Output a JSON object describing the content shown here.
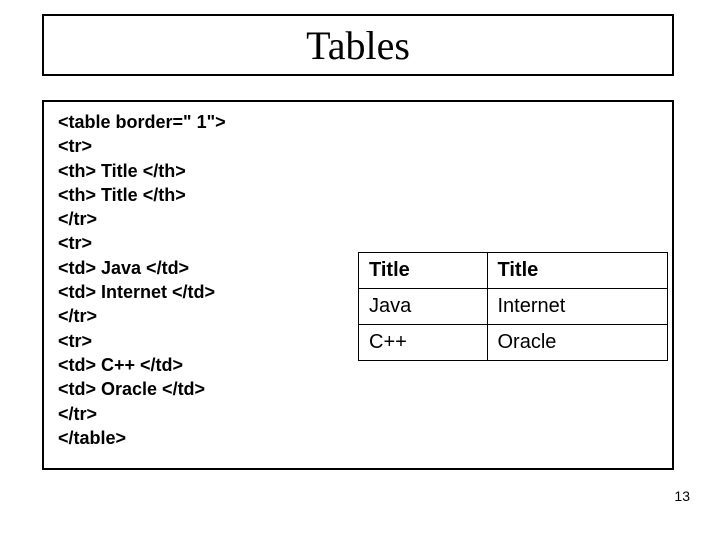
{
  "slide": {
    "title": "Tables",
    "page_number": "13"
  },
  "code": {
    "l1": "<table border=\" 1\">",
    "l2": "<tr>",
    "l3": "<th> Title </th>",
    "l4": "<th> Title </th>",
    "l5": "</tr>",
    "l6": "<tr>",
    "l7": "<td> Java </td>",
    "l8": "<td> Internet </td>",
    "l9": "</tr>",
    "l10": "<tr>",
    "l11": "<td> C++ </td>",
    "l12": "<td> Oracle </td>",
    "l13": "</tr>",
    "l14": "</table>"
  },
  "chart_data": {
    "type": "table",
    "headers": [
      "Title",
      "Title"
    ],
    "rows": [
      [
        "Java",
        "Internet"
      ],
      [
        "C++",
        "Oracle"
      ]
    ]
  }
}
